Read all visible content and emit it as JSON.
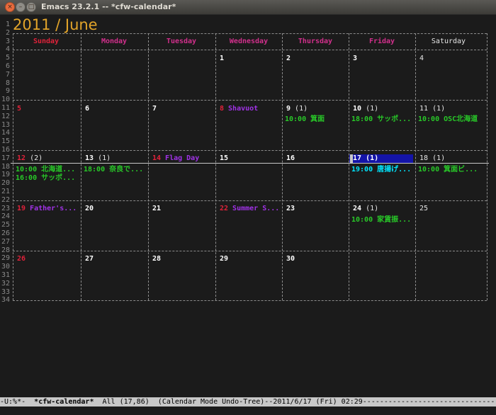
{
  "window": {
    "title": "Emacs 23.2.1 -- *cfw-calendar*",
    "close_glyph": "×",
    "minimize_glyph": "–",
    "maximize_glyph": "□"
  },
  "calendar": {
    "heading": "2011 / June",
    "days": [
      "Sunday",
      "Monday",
      "Tuesday",
      "Wednesday",
      "Thursday",
      "Friday",
      "Saturday"
    ],
    "line_numbers": [
      "1",
      "2",
      "3",
      "4",
      "5",
      "6",
      "7",
      "8",
      "9",
      "10",
      "11",
      "12",
      "13",
      "14",
      "15",
      "16",
      "17",
      "18",
      "19",
      "20",
      "21",
      "22",
      "23",
      "24",
      "25",
      "26",
      "27",
      "28",
      "29",
      "30",
      "31",
      "32",
      "33",
      "34"
    ],
    "weeks": [
      [
        {
          "day": "",
          "type": "blank"
        },
        {
          "day": "",
          "type": "blank"
        },
        {
          "day": "",
          "type": "blank"
        },
        {
          "day": "1",
          "type": "normal"
        },
        {
          "day": "2",
          "type": "normal"
        },
        {
          "day": "3",
          "type": "normal"
        },
        {
          "day": "4",
          "type": "saturday"
        }
      ],
      [
        {
          "day": "5",
          "type": "sunday"
        },
        {
          "day": "6",
          "type": "normal"
        },
        {
          "day": "7",
          "type": "normal"
        },
        {
          "day": "8",
          "type": "holiday",
          "holiday": "Shavuot"
        },
        {
          "day": "9",
          "type": "normal",
          "count": "(1)",
          "events": [
            "10:00 箕面"
          ]
        },
        {
          "day": "10",
          "type": "normal",
          "count": "(1)",
          "events": [
            "18:00 サッポ..."
          ]
        },
        {
          "day": "11",
          "type": "saturday",
          "count": "(1)",
          "events": [
            "10:00 OSC北海道"
          ]
        }
      ],
      [
        {
          "day": "12",
          "type": "sunday",
          "count": "(2)",
          "events": [
            "10:00 北海道...",
            "16:00 サッポ..."
          ]
        },
        {
          "day": "13",
          "type": "normal",
          "count": "(1)",
          "events": [
            "18:00 奈良で..."
          ]
        },
        {
          "day": "14",
          "type": "holiday",
          "holiday": "Flag Day"
        },
        {
          "day": "15",
          "type": "normal"
        },
        {
          "day": "16",
          "type": "normal"
        },
        {
          "day": "17",
          "type": "selected",
          "count": "(1)",
          "events": [
            "19:00 唐揚げ..."
          ]
        },
        {
          "day": "18",
          "type": "saturday",
          "count": "(1)",
          "events": [
            "10:00 箕面ビ..."
          ]
        }
      ],
      [
        {
          "day": "19",
          "type": "holiday",
          "holiday": "Father's..."
        },
        {
          "day": "20",
          "type": "normal"
        },
        {
          "day": "21",
          "type": "normal"
        },
        {
          "day": "22",
          "type": "holiday",
          "holiday": "Summer S..."
        },
        {
          "day": "23",
          "type": "normal"
        },
        {
          "day": "24",
          "type": "normal",
          "count": "(1)",
          "events": [
            "10:00 家賃振..."
          ]
        },
        {
          "day": "25",
          "type": "saturday"
        }
      ],
      [
        {
          "day": "26",
          "type": "sunday"
        },
        {
          "day": "27",
          "type": "normal"
        },
        {
          "day": "28",
          "type": "normal"
        },
        {
          "day": "29",
          "type": "normal"
        },
        {
          "day": "30",
          "type": "normal"
        },
        {
          "day": "",
          "type": "blank"
        },
        {
          "day": "",
          "type": "blank"
        }
      ]
    ]
  },
  "modeline": {
    "status": "-U:%*-",
    "buffer": "*cfw-calendar*",
    "position": "All (17,86)",
    "modes": "(Calendar Mode Undo-Tree)--2011/6/17 (Fri) 02:29",
    "fill": "------------------------------------"
  },
  "colors": {
    "background": "#1b1b1b",
    "heading": "#e2a42a",
    "sunday": "#e0223a",
    "weekday_header": "#d22f8c",
    "saturday_header": "#e6e6e6",
    "holiday": "#a032e6",
    "event": "#28c828",
    "selected_bg": "#1414a8",
    "selected_event": "#00e6ff",
    "border": "#8d8d8d"
  }
}
